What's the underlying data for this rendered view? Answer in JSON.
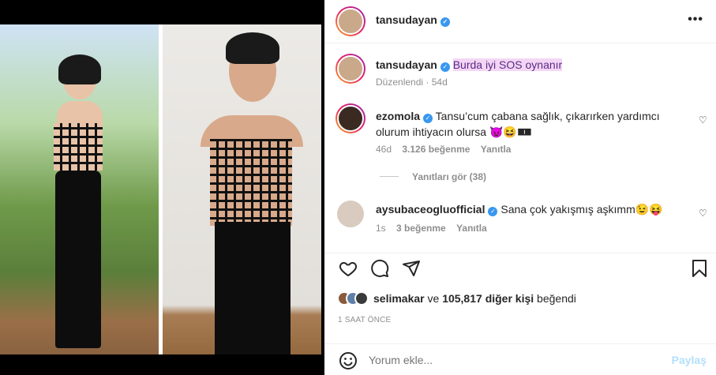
{
  "post": {
    "author": "tansudayan",
    "caption": "Burda iyi SOS oynanır",
    "edited_label": "Düzenlendi",
    "edited_time": "54d",
    "time_ago": "1 SAAT ÖNCE"
  },
  "comments": [
    {
      "username": "ezomola",
      "text": "Tansu’cum çabana sağlık, çıkarırken yardımcı olurum ihtiyacın olursa 😈😆🀰",
      "time": "46d",
      "likes": "3.126 beğenme",
      "reply_label": "Yanıtla",
      "view_replies": "Yanıtları gör (38)"
    },
    {
      "username": "aysubaceogluofficial",
      "text": "Sana çok yakışmış aşkımm😉😝",
      "time": "1s",
      "likes": "3 beğenme",
      "reply_label": "Yanıtla"
    }
  ],
  "likes_summary": {
    "user": "selimakar",
    "connector": "ve",
    "count": "105,817",
    "rest": "diğer kişi",
    "suffix": "beğendi"
  },
  "comment_input": {
    "placeholder": "Yorum ekle...",
    "post_label": "Paylaş"
  },
  "icons": {
    "more": "more-horizontal-icon",
    "heart": "heart-icon",
    "comment": "comment-icon",
    "share": "share-icon",
    "save": "bookmark-icon",
    "emoji": "emoji-icon",
    "verified": "verified-badge-icon"
  },
  "colors": {
    "verified": "#3897f0",
    "link": "#0095f6",
    "highlight_bg": "#f3d6f5"
  }
}
